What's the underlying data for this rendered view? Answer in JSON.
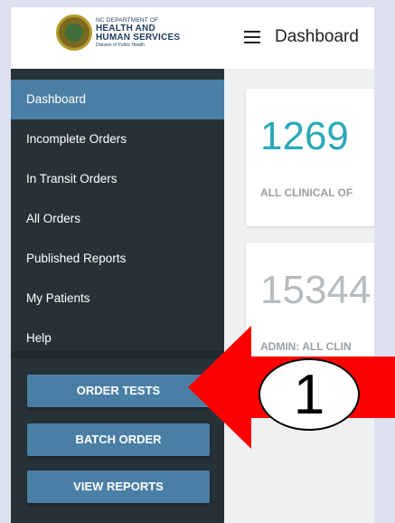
{
  "header": {
    "logo": {
      "line1": "NC DEPARTMENT OF",
      "line2": "HEALTH AND",
      "line3": "HUMAN SERVICES",
      "line4": "Division of Public Health"
    },
    "menu_icon": "hamburger-icon",
    "title": "Dashboard"
  },
  "sidebar": {
    "items": [
      {
        "label": "Dashboard",
        "active": true
      },
      {
        "label": "Incomplete Orders"
      },
      {
        "label": "In Transit Orders"
      },
      {
        "label": "All Orders"
      },
      {
        "label": "Published Reports"
      },
      {
        "label": "My Patients"
      },
      {
        "label": "Help"
      }
    ],
    "buttons": [
      {
        "label": "ORDER TESTS"
      },
      {
        "label": "BATCH ORDER"
      },
      {
        "label": "VIEW REPORTS"
      }
    ]
  },
  "cards": [
    {
      "value": "1269",
      "label": "ALL CLINICAL OF",
      "color": "#29a9b8"
    },
    {
      "value": "15344",
      "label": "ADMIN: ALL CLIN",
      "color": "#b6bcc0"
    }
  ],
  "annotation": {
    "step": "1",
    "arrow_color": "#ff0000"
  },
  "colors": {
    "sidebar_bg": "#263238",
    "accent": "#4a7fa5",
    "content_bg": "#eef0f2"
  }
}
